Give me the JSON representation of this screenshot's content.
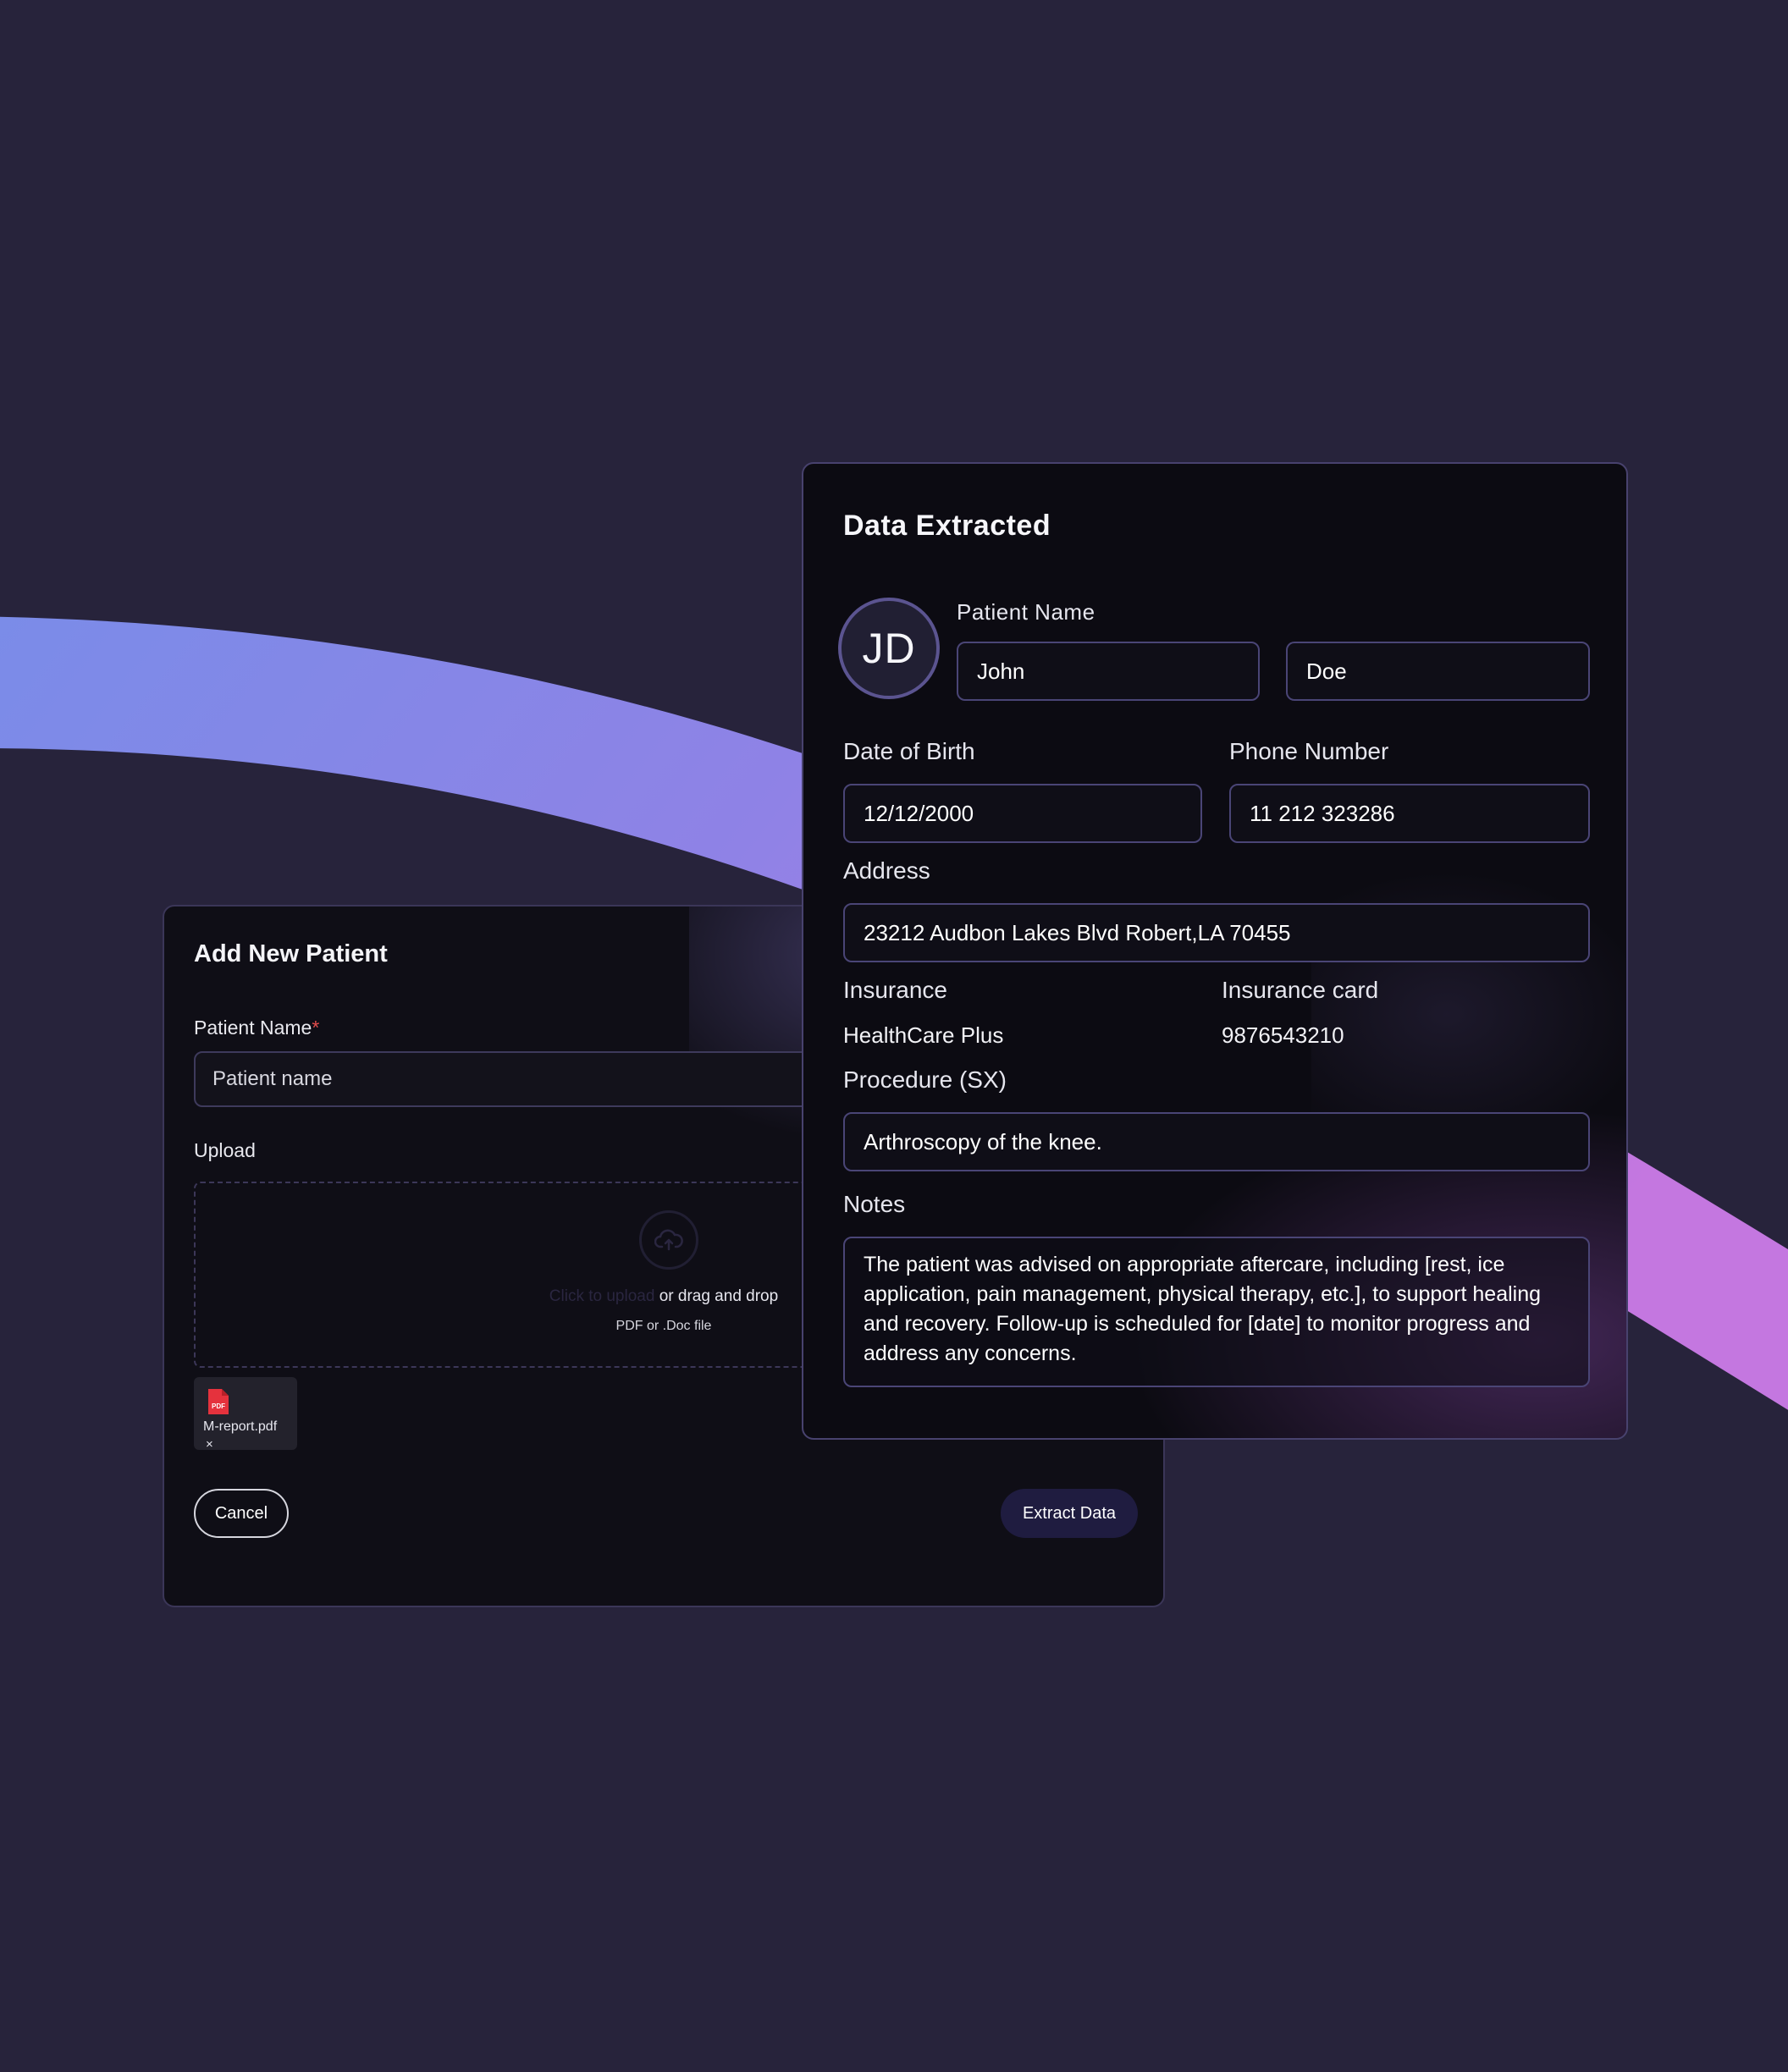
{
  "add_patient": {
    "title": "Add New Patient",
    "patient_name_label": "Patient Name",
    "required_marker": "*",
    "patient_name_placeholder": "Patient name",
    "upload_label": "Upload",
    "upload_link": "Click to upload",
    "upload_hint": " or drag and drop",
    "upload_types": "PDF or .Doc file",
    "file": {
      "icon_text": "PDF",
      "name": "M-report.pdf",
      "remove": "×"
    },
    "cancel_label": "Cancel",
    "extract_label": "Extract Data"
  },
  "extracted": {
    "title": "Data Extracted",
    "avatar_initials": "JD",
    "patient_name_label": "Patient Name",
    "first_name": "John",
    "last_name": "Doe",
    "dob_label": "Date of Birth",
    "dob": "12/12/2000",
    "phone_label": "Phone Number",
    "phone": "11 212 323286",
    "address_label": "Address",
    "address": "23212 Audbon Lakes Blvd Robert,LA 70455",
    "insurance_label": "Insurance",
    "insurance": "HealthCare Plus",
    "insurance_card_label": "Insurance card",
    "insurance_card": "9876543210",
    "procedure_label": "Procedure (SX)",
    "procedure": "Arthroscopy of the  knee.",
    "notes_label": "Notes",
    "notes": "The patient was advised on appropriate aftercare, including [rest, ice application, pain management, physical therapy, etc.], to support healing and recovery. Follow-up is scheduled for [date] to monitor progress and address any concerns."
  },
  "colors": {
    "background": "#27233b",
    "arc_start": "#7a8ce8",
    "arc_end": "#c477e0",
    "card": "#0f0e16",
    "required": "#e24c4c",
    "pdf_red": "#e5323d"
  }
}
